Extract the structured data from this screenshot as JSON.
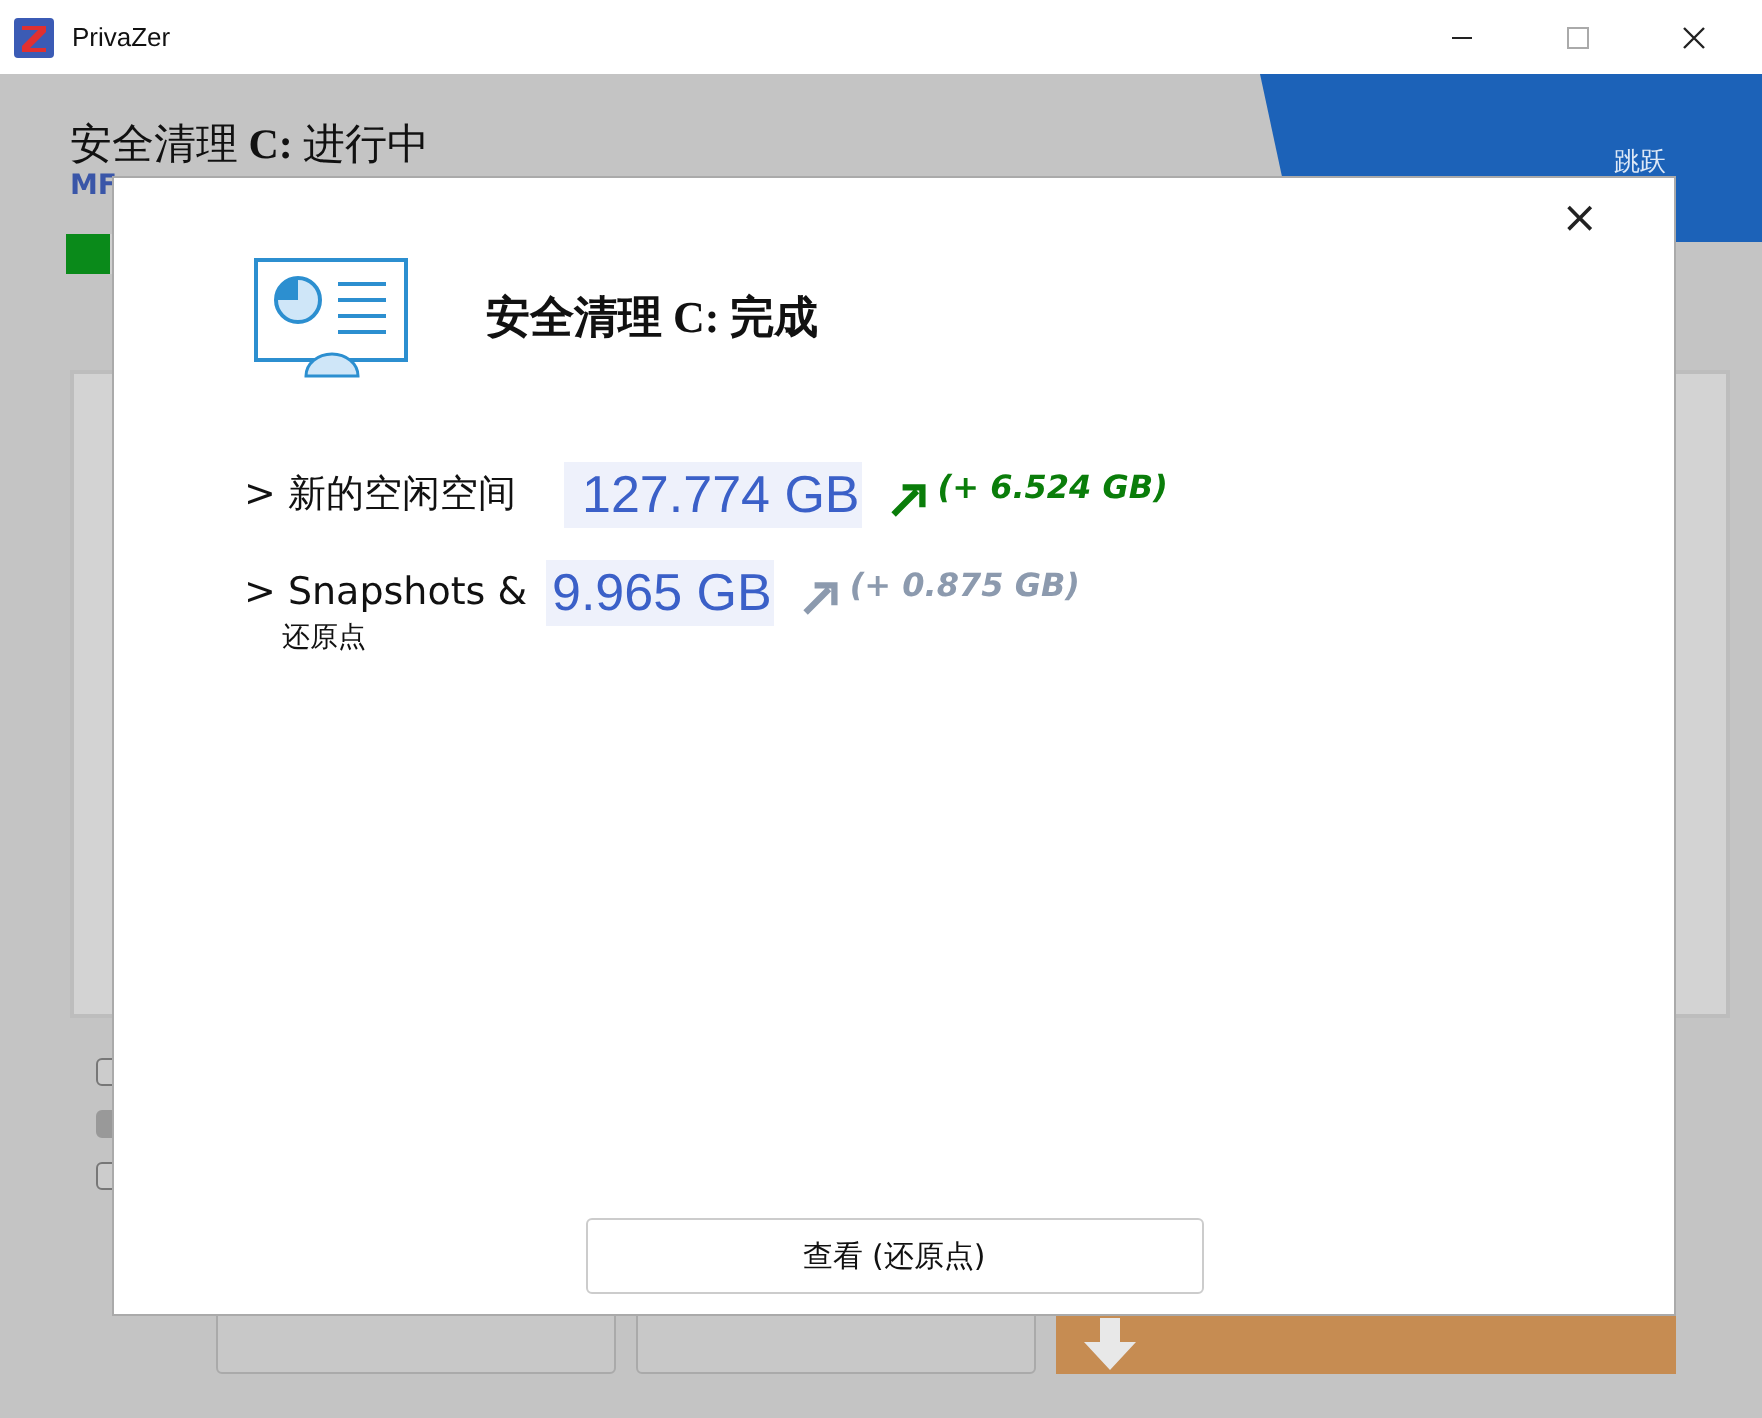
{
  "window": {
    "title": "PrivaZer"
  },
  "background": {
    "title": "安全清理 **C:** 进行中",
    "subtitle": "MF",
    "corner_label": "跳跃",
    "progress": {
      "level": 0.03
    },
    "checkboxes": [
      {
        "checked": false
      },
      {
        "checked": true
      },
      {
        "checked": false
      }
    ],
    "buttons": [
      {
        "kind": "plain"
      },
      {
        "kind": "plain"
      },
      {
        "kind": "donate"
      }
    ]
  },
  "dialog": {
    "title": "安全清理 **C:** 完成",
    "close": "×",
    "rows": [
      {
        "label": "> 新的空闲空间",
        "value": "127.774 GB",
        "delta": "(+ 6.524 GB)",
        "color": "#0a7d0a"
      },
      {
        "label": "> Snapshots &",
        "sublabel": "还原点",
        "value": "9.965 GB",
        "delta": "(+ 0.875 GB)",
        "color": "#8c9aae"
      }
    ],
    "button": "查看 (还原点)"
  }
}
